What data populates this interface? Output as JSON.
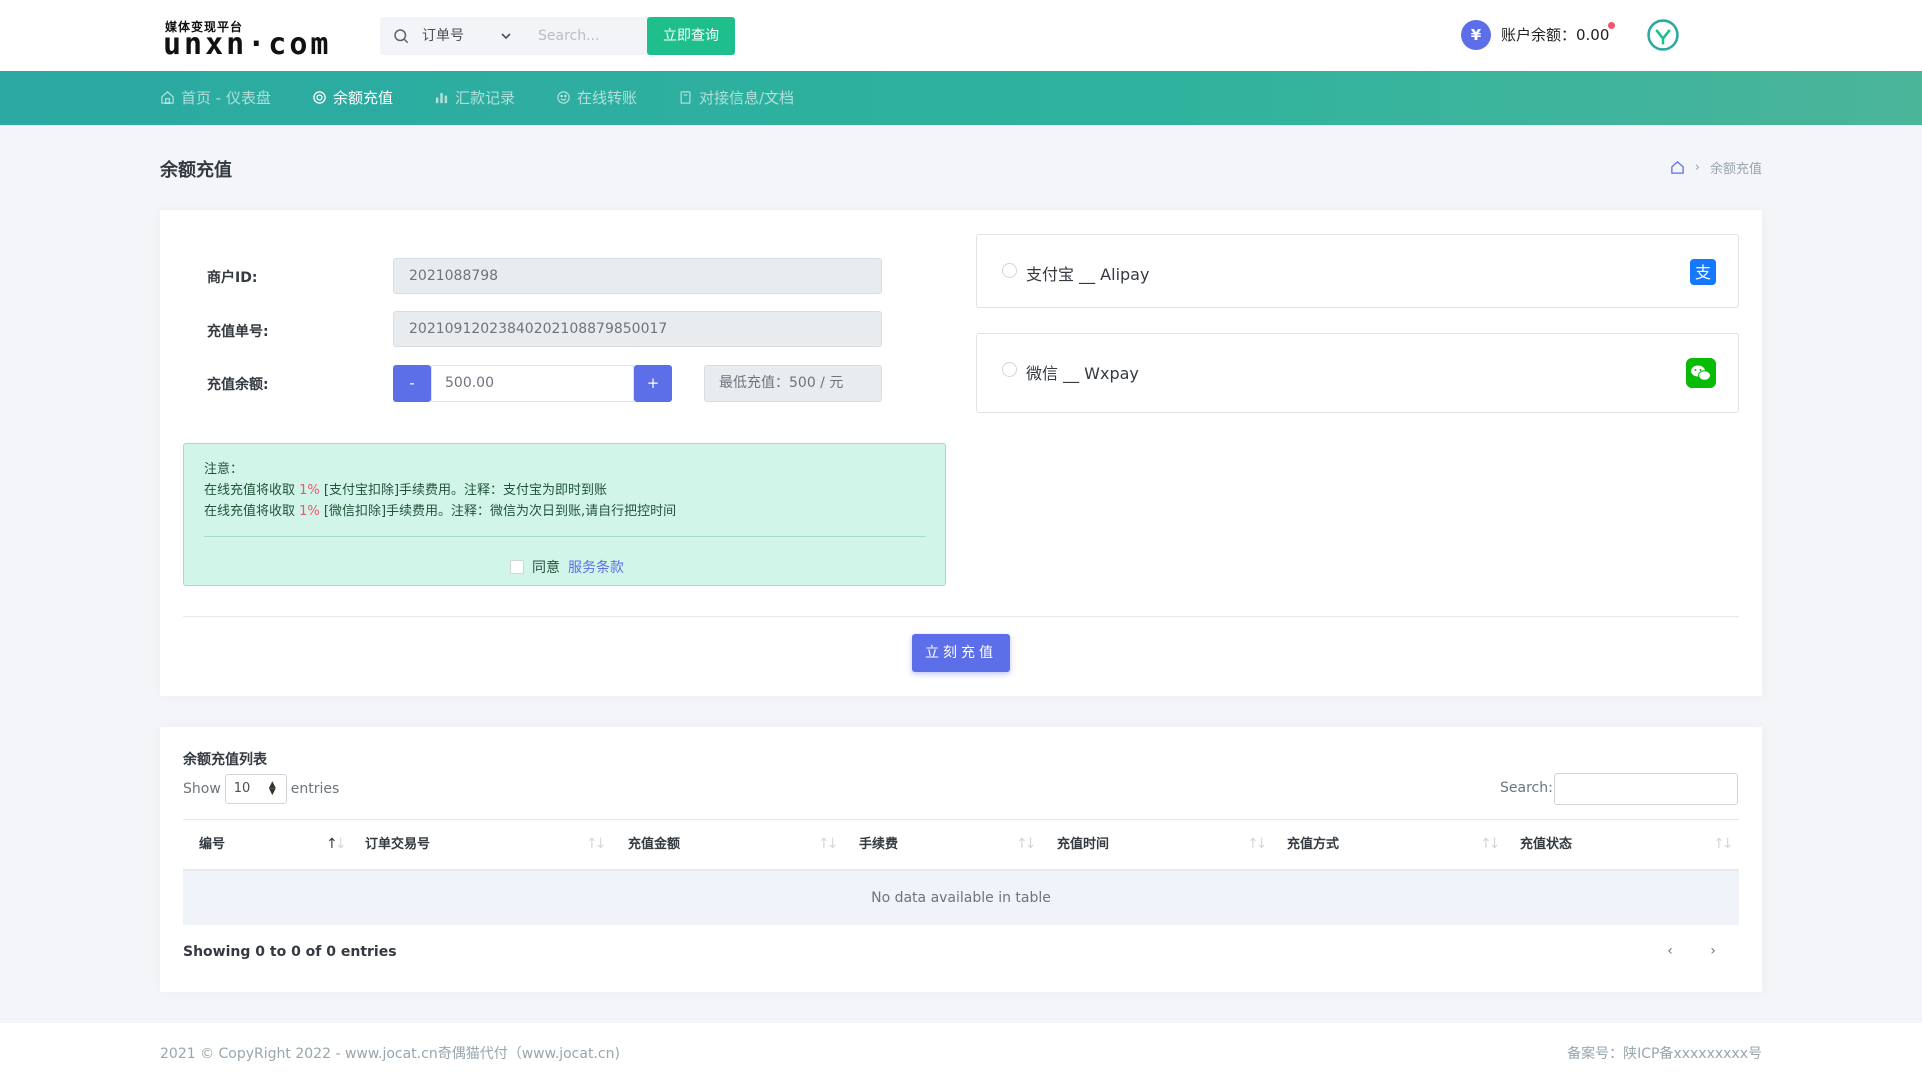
{
  "logo": {
    "small": "媒体变现平台",
    "big": "unxn·com"
  },
  "search": {
    "type_label": "订单号",
    "placeholder": "Search...",
    "button": "立即查询"
  },
  "account": {
    "balance_label": "账户余额：0.00"
  },
  "nav": [
    {
      "label": "首页 - 仪表盘",
      "icon": "home-icon"
    },
    {
      "label": "余额充值",
      "icon": "target-icon"
    },
    {
      "label": "汇款记录",
      "icon": "bar-chart-icon"
    },
    {
      "label": "在线转账",
      "icon": "smile-icon"
    },
    {
      "label": "对接信息/文档",
      "icon": "document-icon"
    }
  ],
  "page": {
    "title": "余额充值",
    "breadcrumb": "余额充值"
  },
  "form": {
    "merchant_label": "商户ID:",
    "merchant_id": "2021088798",
    "order_label": "充值单号:",
    "order_no": "20210912023840202108879850017",
    "amount_label": "充值余额:",
    "minus": "-",
    "amount": "500.00",
    "plus": "+",
    "min_recharge": "最低充值：500 / 元",
    "submit": "立刻充值"
  },
  "notice": {
    "title": "注意：",
    "line1_pre": "在线充值将收取 ",
    "line1_pct": "1%",
    "line1_post": " [支付宝扣除]手续费用。注释：支付宝为即时到账",
    "line2_pre": "在线充值将收取 ",
    "line2_pct": "1%",
    "line2_post": " [微信扣除]手续费用。注释：微信为次日到账,请自行把控时间",
    "agree": "同意",
    "terms": "服务条款"
  },
  "payments": [
    {
      "label": "支付宝 __ Alipay",
      "icon": "alipay-icon",
      "color": "#1677ff"
    },
    {
      "label": "微信 __ Wxpay",
      "icon": "wechat-icon",
      "color": "#09bb07"
    }
  ],
  "table": {
    "title": "余额充值列表",
    "show": "Show",
    "length": "10",
    "entries": "entries",
    "search_label": "Search:",
    "columns": [
      "编号",
      "订单交易号",
      "充值金额",
      "手续费",
      "充值时间",
      "充值方式",
      "充值状态"
    ],
    "empty": "No data available in table",
    "info": "Showing 0 to 0 of 0 entries",
    "prev": "‹",
    "next": "›"
  },
  "footer": {
    "left": "2021 © CopyRight 2022 - www.jocat.cn奇偶猫代付（www.jocat.cn)",
    "right": "备案号：陕ICP备xxxxxxxxx号"
  },
  "colors": {
    "primary": "#5c6fe8",
    "success": "#1ebf8c",
    "nav_teal": "#2ba9a2",
    "danger": "#f1556c"
  }
}
